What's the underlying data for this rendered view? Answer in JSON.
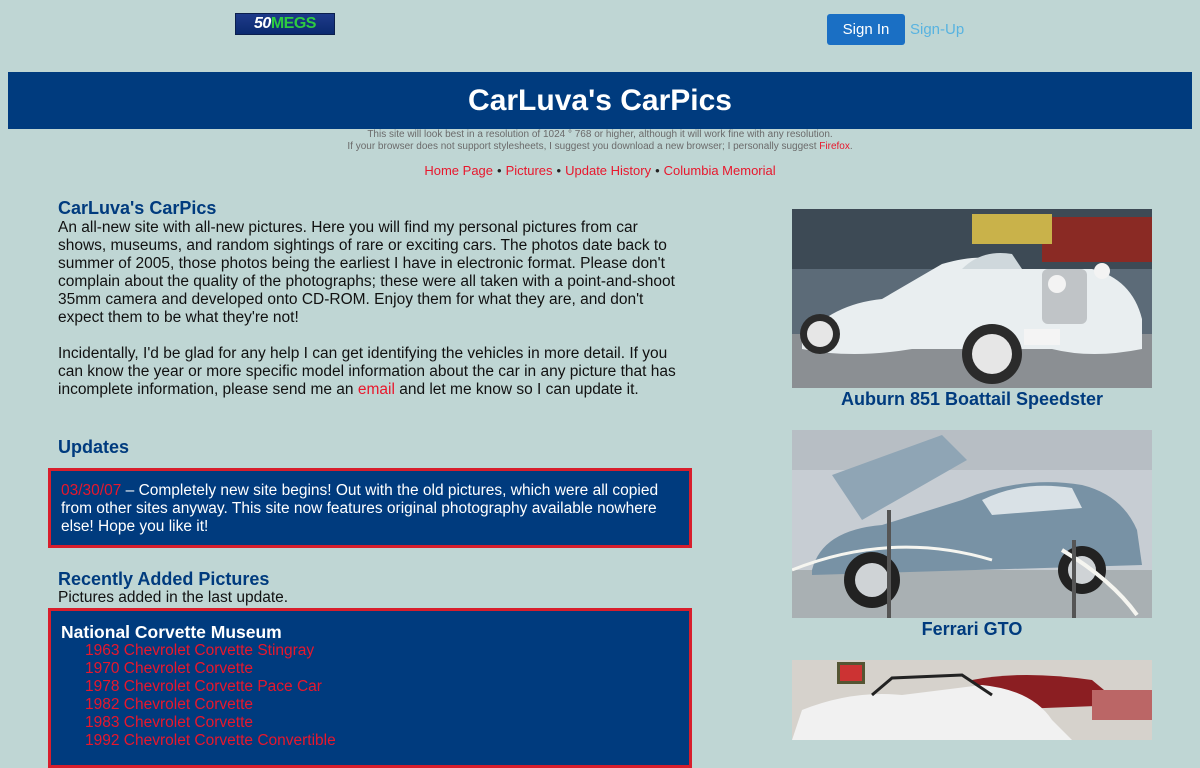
{
  "colors": {
    "page_bg": "#bfd6d4",
    "navy": "#003b7e",
    "red": "#e8172c",
    "btn_blue": "#1a6fc4",
    "signup": "#58b3e0",
    "box_border": "#d81e2c"
  },
  "topbar": {
    "logo_a": "50",
    "logo_b": "MEGS",
    "signin_label": "Sign In",
    "signup_label": "Sign-Up"
  },
  "banner": {
    "title": "CarLuva's CarPics"
  },
  "notice": {
    "line1": "This site will look best in a resolution of 1024 ° 768 or higher, although it will work fine with any resolution.",
    "line2_pre": "If your browser does not support stylesheets, I suggest you download a new browser; I personally suggest ",
    "line2_link": "Firefox",
    "line2_post": "."
  },
  "nav": {
    "items": [
      "Home Page",
      "Pictures",
      "Update History",
      "Columbia Memorial"
    ],
    "separator": "•"
  },
  "intro": {
    "heading": "CarLuva's CarPics",
    "para1": "An all-new site with all-new pictures.  Here you will find my personal pictures from car shows, museums, and random sightings of rare or exciting cars.  The photos date back to summer of 2005, those photos being the earliest I have in electronic format.  Please don't complain about the quality of the photographs; these were all taken with a point-and-shoot 35mm camera and developed onto CD-ROM.  Enjoy them for what they are, and don't expect them to be what they're not!",
    "para2_pre": "Incidentally, I'd be glad for any help I can get identifying the vehicles in more detail.  If you can know the year or more specific model information about the car in any picture that has incomplete information, please send me an ",
    "para2_link": "email",
    "para2_post": " and let me know so I can update it."
  },
  "updates": {
    "heading": "Updates",
    "date": "03/30/07",
    "text": " – Completely new site begins!  Out with the old pictures, which were all copied from other sites anyway.  This site now features original photography available nowhere else!  Hope you like it!"
  },
  "recent": {
    "heading": "Recently Added Pictures",
    "subtitle": "Pictures added in the last update.",
    "museum": "National Corvette Museum",
    "cars": [
      "1963 Chevrolet Corvette Stingray",
      "1970 Chevrolet Corvette",
      "1978 Chevrolet Corvette Pace Car",
      "1982 Chevrolet Corvette",
      "1983 Chevrolet Corvette",
      "1992 Chevrolet Corvette Convertible"
    ]
  },
  "featured": [
    {
      "caption": "Auburn 851 Boattail Speedster",
      "icon": "car-photo-white-roadster"
    },
    {
      "caption": "Ferrari GTO",
      "icon": "car-photo-blue-coupe"
    },
    {
      "caption": "",
      "icon": "car-photo-white-convertible"
    }
  ]
}
